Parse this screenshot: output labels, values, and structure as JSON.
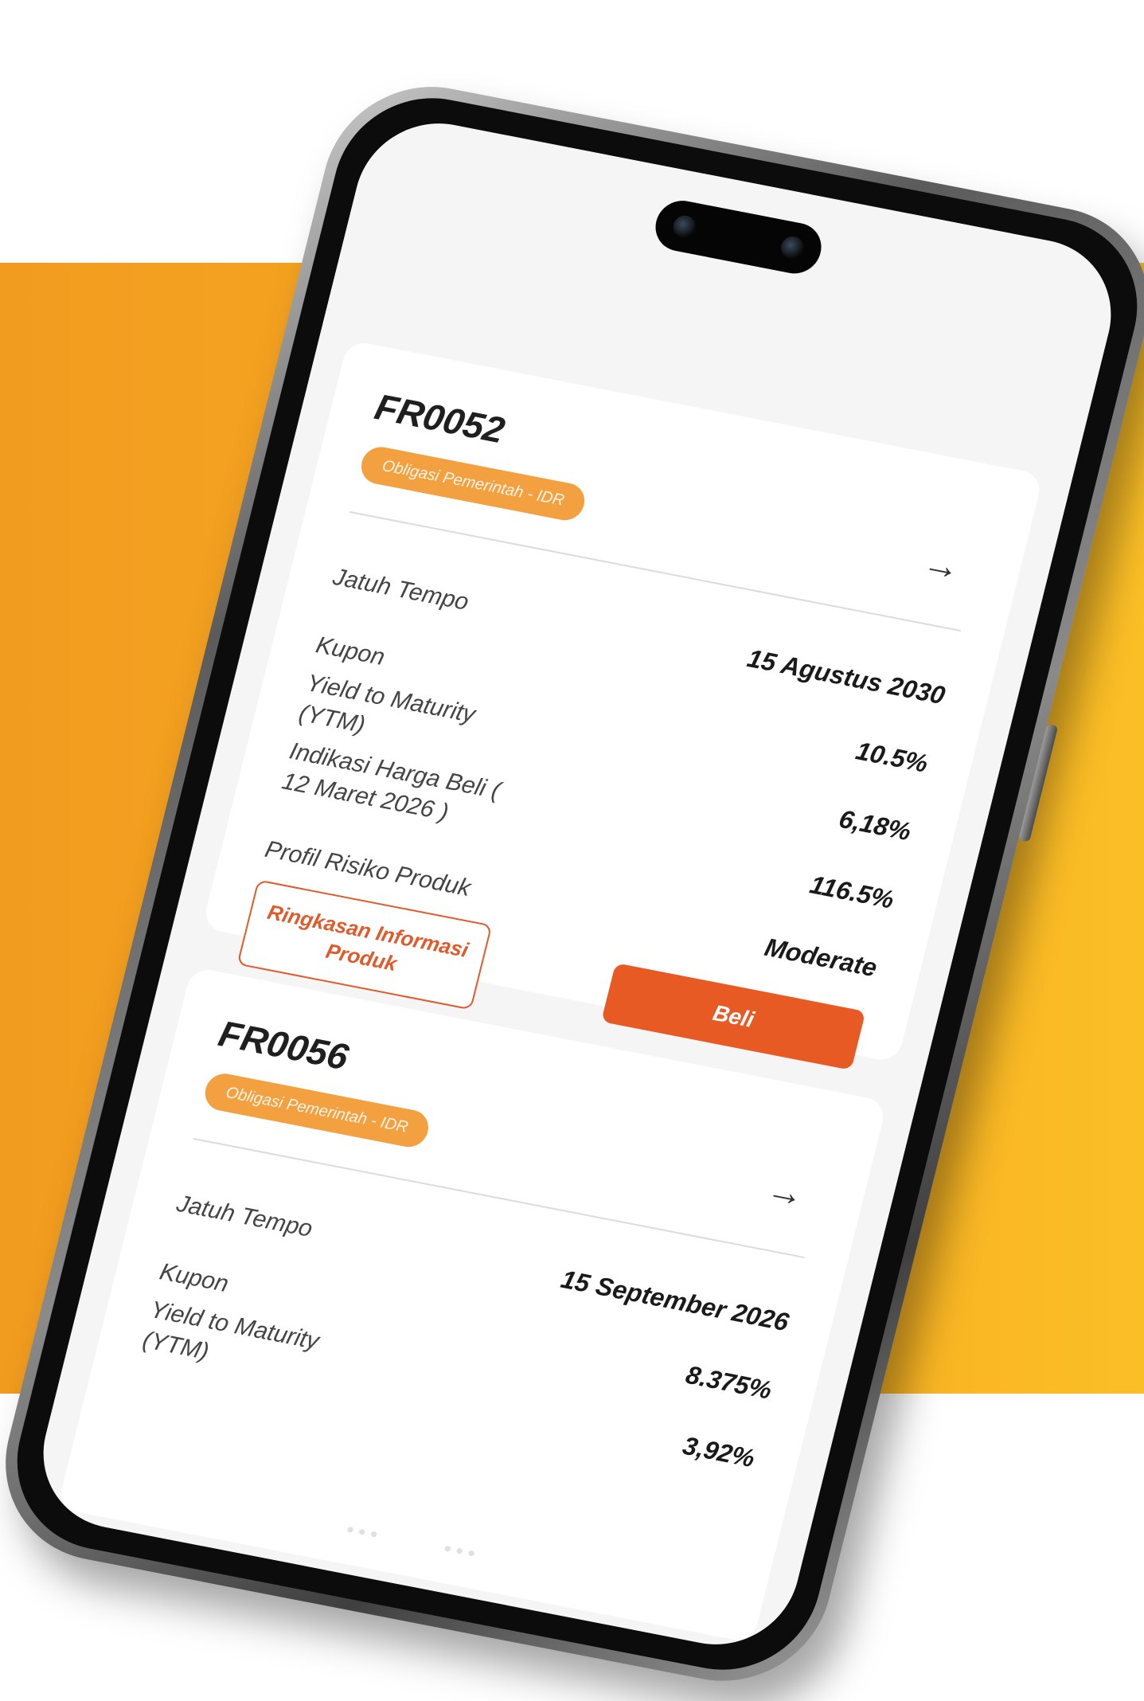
{
  "theme": {
    "accent": "#e85a24",
    "badge": "#f3a040",
    "backdrop": "#f6a821"
  },
  "cards": [
    {
      "code": "FR0052",
      "badge": "Obligasi Pemerintah - IDR",
      "arrow_icon": "arrow-right-icon",
      "rows": [
        {
          "label": "Jatuh Tempo",
          "value": "15 Agustus 2030"
        },
        {
          "label": "Kupon",
          "value": "10.5%"
        },
        {
          "label": "Yield to Maturity (YTM)",
          "value": "6,18%"
        },
        {
          "label": "Indikasi Harga Beli ( 12 Maret 2026 )",
          "value": "116.5%"
        },
        {
          "label": "Profil Risiko Produk",
          "value": "Moderate"
        }
      ],
      "summary_button": "Ringkasan Informasi Produk",
      "buy_button": "Beli"
    },
    {
      "code": "FR0056",
      "badge": "Obligasi Pemerintah - IDR",
      "arrow_icon": "arrow-right-icon",
      "rows": [
        {
          "label": "Jatuh Tempo",
          "value": "15 September 2026"
        },
        {
          "label": "Kupon",
          "value": "8.375%"
        },
        {
          "label": "Yield to Maturity (YTM)",
          "value": "3,92%"
        }
      ]
    }
  ]
}
